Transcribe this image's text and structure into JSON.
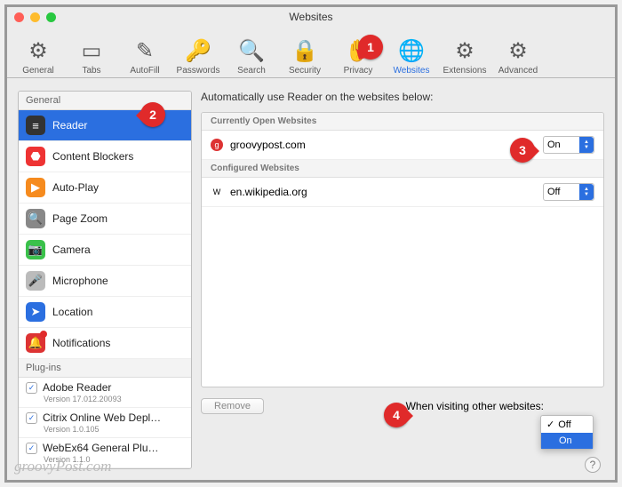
{
  "window": {
    "title": "Websites"
  },
  "toolbar": {
    "items": [
      {
        "label": "General"
      },
      {
        "label": "Tabs"
      },
      {
        "label": "AutoFill"
      },
      {
        "label": "Passwords"
      },
      {
        "label": "Search"
      },
      {
        "label": "Security"
      },
      {
        "label": "Privacy"
      },
      {
        "label": "Websites"
      },
      {
        "label": "Extensions"
      },
      {
        "label": "Advanced"
      }
    ]
  },
  "sidebar": {
    "section_general": "General",
    "items": [
      {
        "label": "Reader"
      },
      {
        "label": "Content Blockers"
      },
      {
        "label": "Auto-Play"
      },
      {
        "label": "Page Zoom"
      },
      {
        "label": "Camera"
      },
      {
        "label": "Microphone"
      },
      {
        "label": "Location"
      },
      {
        "label": "Notifications"
      }
    ],
    "section_plugins": "Plug-ins",
    "plugins": [
      {
        "name": "Adobe Reader",
        "ver": "Version 17.012.20093"
      },
      {
        "name": "Citrix Online Web Depl…",
        "ver": "Version 1.0.105"
      },
      {
        "name": "WebEx64 General Plu…",
        "ver": "Version 1.1.0"
      }
    ]
  },
  "content": {
    "heading": "Automatically use Reader on the websites below:",
    "open_header": "Currently Open Websites",
    "open_site": "groovypost.com",
    "open_value": "On",
    "configured_header": "Configured Websites",
    "configured_site": "en.wikipedia.org",
    "configured_value": "Off",
    "remove": "Remove",
    "other_label": "When visiting other websites:",
    "dropdown": {
      "off": "Off",
      "on": "On"
    }
  },
  "callouts": {
    "c1": "1",
    "c2": "2",
    "c3": "3",
    "c4": "4"
  },
  "watermark": "groovyPost.com"
}
